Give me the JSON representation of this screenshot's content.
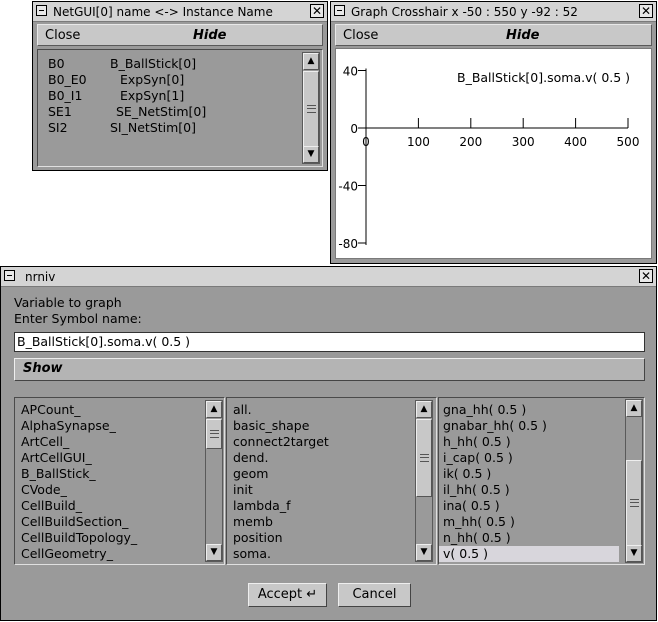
{
  "netgui": {
    "title": "NetGUI[0] name <-> Instance Name",
    "close_label": "Close",
    "hide_label": "Hide",
    "rows": [
      {
        "name": "B0",
        "instance": "B_BallStick[0]"
      },
      {
        "name": "B0_E0",
        "instance": "ExpSyn[0]"
      },
      {
        "name": "B0_I1",
        "instance": "ExpSyn[1]"
      },
      {
        "name": "SE1",
        "instance": "SE_NetStim[0]"
      },
      {
        "name": "SI2",
        "instance": "SI_NetStim[0]"
      }
    ]
  },
  "graph": {
    "title": "Graph Crosshair x -50 : 550  y -92 : 52",
    "close_label": "Close",
    "hide_label": "Hide",
    "plot_label": "B_BallStick[0].soma.v( 0.5 )",
    "chart_data": {
      "type": "line",
      "title": "",
      "series": [
        {
          "name": "B_BallStick[0].soma.v( 0.5 )",
          "x": [],
          "y": []
        }
      ],
      "x_ticks": [
        0,
        100,
        200,
        300,
        400,
        500
      ],
      "y_ticks": [
        40,
        0,
        -40,
        -80
      ],
      "xlim": [
        -50,
        550
      ],
      "ylim": [
        -92,
        52
      ],
      "grid": false
    }
  },
  "nrniv": {
    "title": "nrniv",
    "prompt": "Variable to graph",
    "enter_label": "Enter  Symbol name:",
    "symbol_value": "B_BallStick[0].soma.v( 0.5 )",
    "show_label": "Show",
    "list1": [
      "APCount_",
      "AlphaSynapse_",
      "ArtCell_",
      "ArtCellGUI_",
      "B_BallStick_",
      "CVode_",
      "CellBuild_",
      "CellBuildSection_",
      "CellBuildTopology_",
      "CellGeometry_"
    ],
    "list2": [
      "all.",
      "basic_shape",
      "connect2target",
      "dend.",
      "geom",
      "init",
      "lambda_f",
      "memb",
      "position",
      "soma."
    ],
    "list3": [
      "gna_hh( 0.5 )",
      "gnabar_hh( 0.5 )",
      "h_hh( 0.5 )",
      "i_cap( 0.5 )",
      "ik( 0.5 )",
      "il_hh( 0.5 )",
      "ina( 0.5 )",
      "m_hh( 0.5 )",
      "n_hh( 0.5 )",
      "v( 0.5 )"
    ],
    "list3_selected": "v( 0.5 )",
    "accept_label": "Accept",
    "cancel_label": "Cancel"
  }
}
